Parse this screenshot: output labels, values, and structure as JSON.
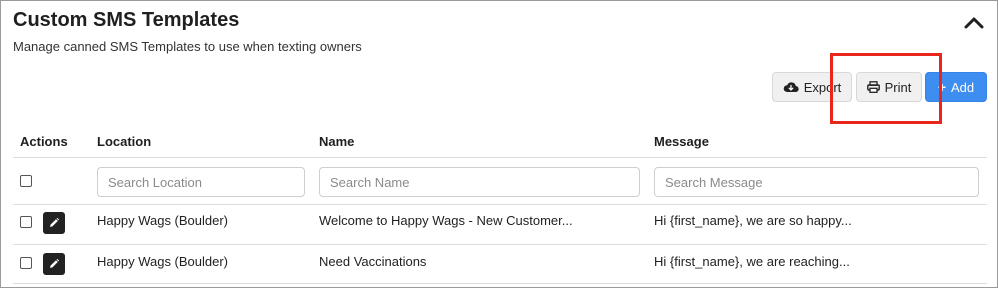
{
  "header": {
    "title": "Custom SMS Templates",
    "subtitle": "Manage canned SMS Templates to use when texting owners",
    "collapse_icon": "chevron-up-icon"
  },
  "toolbar": {
    "export_label": "Export",
    "print_label": "Print",
    "add_label": "Add",
    "add_color": "#3d8ef0",
    "highlight_color": "#e8261c"
  },
  "table": {
    "columns": [
      "Actions",
      "Location",
      "Name",
      "Message"
    ],
    "filters": {
      "location_placeholder": "Search Location",
      "name_placeholder": "Search Name",
      "message_placeholder": "Search Message"
    },
    "rows": [
      {
        "location": "Happy Wags (Boulder)",
        "name": "Welcome to Happy Wags - New Customer...",
        "message": "Hi {first_name}, we are so happy..."
      },
      {
        "location": "Happy Wags (Boulder)",
        "name": "Need Vaccinations",
        "message": "Hi {first_name}, we are reaching..."
      }
    ]
  }
}
